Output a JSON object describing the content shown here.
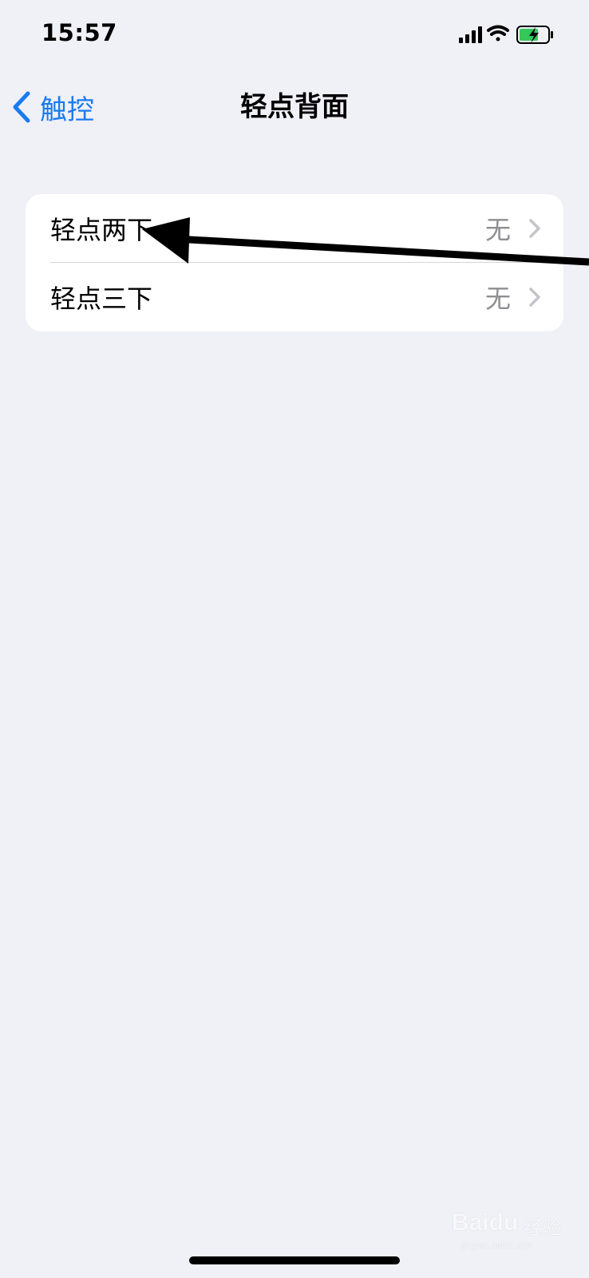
{
  "status_bar": {
    "time": "15:57",
    "icons": [
      "signal-icon",
      "wifi-icon",
      "battery-charging-icon"
    ]
  },
  "nav": {
    "back_label": "触控",
    "back_icon": "chevron-left-icon",
    "title": "轻点背面"
  },
  "settings": {
    "rows": [
      {
        "label": "轻点两下",
        "value": "无"
      },
      {
        "label": "轻点三下",
        "value": "无"
      }
    ]
  },
  "watermark": {
    "brand": "Baidu",
    "brand_cn": "经验",
    "url": "jingyan.baidu.com"
  },
  "colors": {
    "accent": "#1A7BEF",
    "background": "#F0F0F7",
    "secondary_text": "#8E8E93",
    "battery": "#34C759"
  }
}
